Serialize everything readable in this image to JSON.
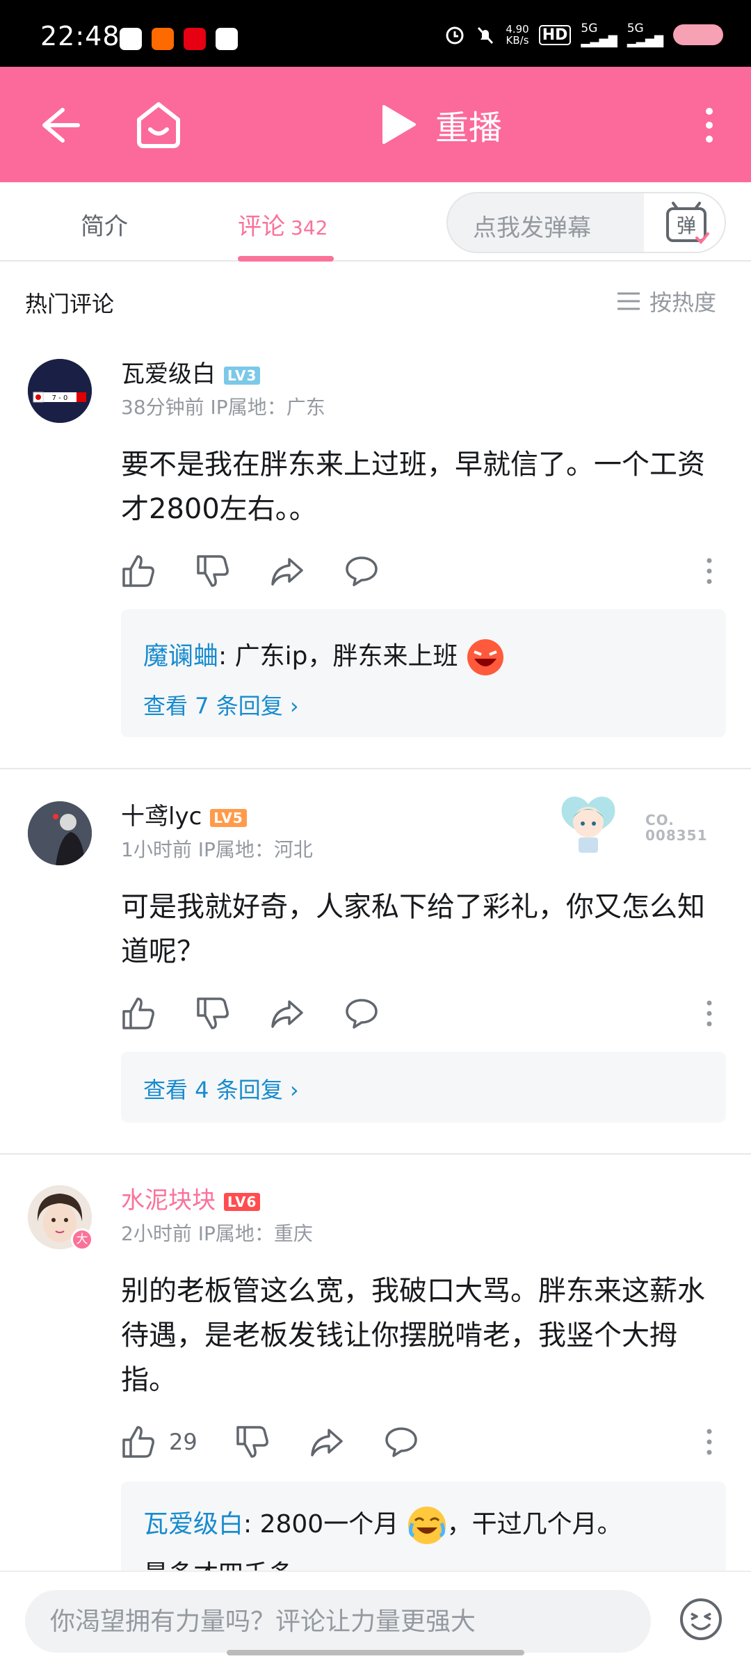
{
  "status_bar": {
    "time": "22:48",
    "net_speed_value": "4.90",
    "net_speed_unit": "KB/s",
    "hd_label": "HD",
    "signal_1": "5G",
    "signal_2": "5G"
  },
  "topbar": {
    "back_icon": "arrow-left-icon",
    "home_icon": "tv-home-icon",
    "replay_label": "重播",
    "more_icon": "more-vertical-icon",
    "background_color": "#fb6a9a"
  },
  "tabs": {
    "intro_label": "简介",
    "comments_label": "评论",
    "comments_count": "342",
    "danmaku_placeholder": "点我发弹幕",
    "danmaku_icon_glyph": "弹",
    "accent_color": "#fb7299"
  },
  "section": {
    "title": "热门评论",
    "sort_label": "按热度"
  },
  "comments": [
    {
      "username": "瓦爱级白",
      "level": "LV3",
      "level_color": "#7bc8e8",
      "time": "38分钟前",
      "ip": "IP属地：广东",
      "text": "要不是我在胖东来上过班，早就信了。一个工资才2800左右。。",
      "reply_author": "魔谰蛐",
      "reply_text": ": 广东ip，胖东来上班",
      "view_replies": "查看 7 条回复"
    },
    {
      "username": "十鸢lyc",
      "level": "LV5",
      "level_color": "#ff9b4b",
      "time": "1小时前",
      "ip": "IP属地：河北",
      "text": "可是我就好奇，人家私下给了彩礼，你又怎么知道呢？",
      "badge_code_line1": "CO.",
      "badge_code_line2": "008351",
      "view_replies": "查看 4 条回复"
    },
    {
      "username": "水泥块块",
      "level": "LV6",
      "level_color": "#ff4d4f",
      "time": "2小时前",
      "ip": "IP属地：重庆",
      "avatar_badge": "大",
      "text": "别的老板管这么宽，我破口大骂。胖东来这薪水待遇，是老板发钱让你摆脱啃老，我竖个大拇指。",
      "likes": "29",
      "reply_author": "瓦爱级白",
      "reply_text": ": 2800一个月",
      "reply_text_2": "，干过几个月。",
      "reply_partial": "最多才四千多"
    }
  ],
  "bottom": {
    "input_placeholder": "你渴望拥有力量吗？评论让力量更强大",
    "emoji_icon": "emoji-face-icon"
  }
}
